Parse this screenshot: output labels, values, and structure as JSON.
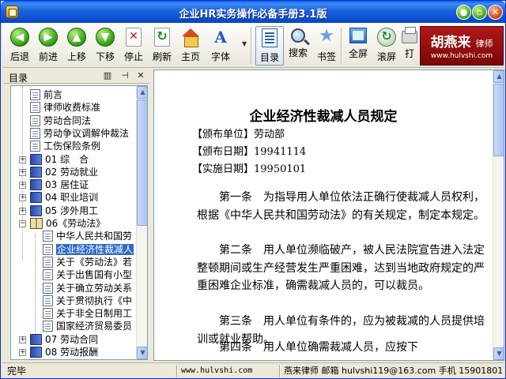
{
  "window": {
    "title": "企业HR实务操作必备手册3.1版"
  },
  "toolbar": {
    "buttons": [
      {
        "label": "后退",
        "icon": "arrow-left-icon"
      },
      {
        "label": "前进",
        "icon": "arrow-right-icon"
      },
      {
        "label": "上移",
        "icon": "arrow-up-icon"
      },
      {
        "label": "下移",
        "icon": "arrow-down-icon"
      },
      {
        "label": "停止",
        "icon": "stop-icon"
      },
      {
        "label": "刷新",
        "icon": "refresh-icon"
      },
      {
        "label": "主页",
        "icon": "home-icon"
      },
      {
        "label": "字体",
        "icon": "font-icon"
      },
      {
        "label": "目录",
        "icon": "toc-icon"
      },
      {
        "label": "搜索",
        "icon": "search-icon"
      },
      {
        "label": "书签",
        "icon": "bookmark-star-icon"
      },
      {
        "label": "全屏",
        "icon": "fullscreen-icon"
      },
      {
        "label": "滚屏",
        "icon": "scroll-icon"
      },
      {
        "label": "打",
        "icon": "print-icon"
      }
    ],
    "logo": {
      "main": "胡燕来",
      "suffix": "律师",
      "url": "www.hulvshi.com"
    }
  },
  "left_pane": {
    "title": "目录",
    "pin": "ㅁ",
    "close": "✕",
    "items": [
      {
        "label": "前言",
        "icon": "doc",
        "expander": ""
      },
      {
        "label": "律师收费标准",
        "icon": "doc",
        "expander": ""
      },
      {
        "label": "劳动合同法",
        "icon": "doc",
        "expander": ""
      },
      {
        "label": "劳动争议调解仲裁法",
        "icon": "doc",
        "expander": ""
      },
      {
        "label": "工伤保险条例",
        "icon": "doc",
        "expander": ""
      },
      {
        "label": "01  综　合",
        "icon": "book",
        "expander": "+"
      },
      {
        "label": "02  劳动就业",
        "icon": "book",
        "expander": "+"
      },
      {
        "label": "03  居住证",
        "icon": "book",
        "expander": "+"
      },
      {
        "label": "04  职业培训",
        "icon": "book",
        "expander": "+"
      },
      {
        "label": "05  涉外用工",
        "icon": "book",
        "expander": "+"
      },
      {
        "label": "06《劳动法》",
        "icon": "book-open",
        "expander": "−"
      },
      {
        "label": "中华人民共和国劳",
        "icon": "doc",
        "expander": ""
      },
      {
        "label": "企业经济性裁减人",
        "icon": "doc",
        "expander": "",
        "selected": true
      },
      {
        "label": "关于《劳动法》若",
        "icon": "doc",
        "expander": ""
      },
      {
        "label": "关于出售国有小型",
        "icon": "doc",
        "expander": ""
      },
      {
        "label": "关于确立劳动关系",
        "icon": "doc",
        "expander": ""
      },
      {
        "label": "关于贯彻执行《中",
        "icon": "doc",
        "expander": ""
      },
      {
        "label": "关于非全日制用工",
        "icon": "doc",
        "expander": ""
      },
      {
        "label": "国家经济贸易委员",
        "icon": "doc",
        "expander": ""
      },
      {
        "label": "07  劳动合同",
        "icon": "book",
        "expander": "+"
      },
      {
        "label": "08  劳动报酬",
        "icon": "book",
        "expander": "+"
      }
    ]
  },
  "document": {
    "title": "企业经济性裁减人员规定",
    "meta": [
      {
        "key": "【颁布单位】",
        "value": "劳动部"
      },
      {
        "key": "【颁布日期】",
        "value": "19941114"
      },
      {
        "key": "【实施日期】",
        "value": "19950101"
      }
    ],
    "paragraphs": [
      "第一条　为指导用人单位依法正确行使裁减人员权利，根据《中华人民共和国劳动法》的有关规定，制定本规定。",
      "第二条　用人单位濒临破产，被人民法院宣告进入法定整顿期间或生产经营发生严重困难，达到当地政府规定的严重困难企业标准，确需裁减人员的，可以裁员。",
      "第三条　用人单位有条件的，应为被裁减的人员提供培训或就业帮助。",
      "第四条　用人单位确需裁减人员，应按下"
    ]
  },
  "statusbar": {
    "status": "完毕",
    "site": "www.hulvshi.com",
    "contact": "燕来律师 邮箱 hulvshi119@163.com 手机 15901801"
  }
}
